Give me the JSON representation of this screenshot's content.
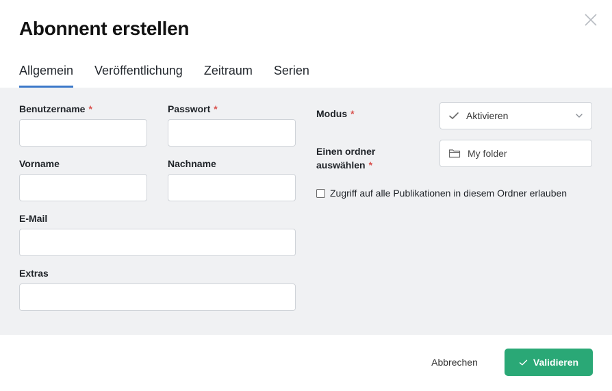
{
  "dialog": {
    "title": "Abonnent erstellen"
  },
  "tabs": [
    {
      "label": "Allgemein",
      "active": true
    },
    {
      "label": "Veröffentlichung",
      "active": false
    },
    {
      "label": "Zeitraum",
      "active": false
    },
    {
      "label": "Serien",
      "active": false
    }
  ],
  "form": {
    "username": {
      "label": "Benutzername",
      "required": "*",
      "value": ""
    },
    "password": {
      "label": "Passwort",
      "required": "*",
      "value": ""
    },
    "firstname": {
      "label": "Vorname",
      "value": ""
    },
    "lastname": {
      "label": "Nachname",
      "value": ""
    },
    "email": {
      "label": "E-Mail",
      "value": ""
    },
    "extras": {
      "label": "Extras",
      "value": ""
    },
    "mode": {
      "label": "Modus",
      "required": "*",
      "selected": "Aktivieren",
      "icon": "check-icon"
    },
    "folder": {
      "label_line1": "Einen ordner",
      "label_line2": "auswählen",
      "required": "*",
      "value": "My folder",
      "icon": "folder-icon"
    },
    "access": {
      "label": "Zugriff auf alle Publikationen in diesem Ordner erlauben",
      "checked": false
    }
  },
  "footer": {
    "cancel_label": "Abbrechen",
    "validate_label": "Validieren"
  },
  "colors": {
    "accent": "#3b78c9",
    "primary_button": "#2aa876",
    "required": "#d9534f",
    "panel_bg": "#f0f1f3"
  }
}
